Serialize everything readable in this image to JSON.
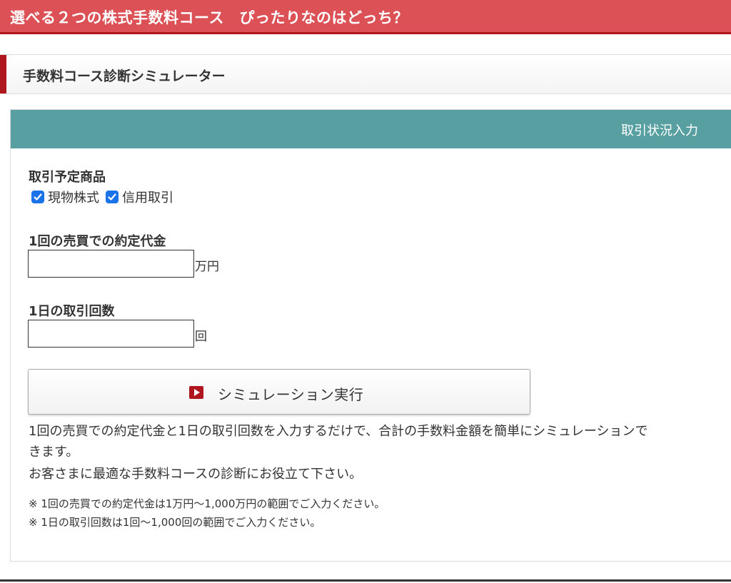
{
  "banner": {
    "title": "選べる２つの株式手数料コース　ぴったりなのはどっち？",
    "color": "#dc5156"
  },
  "section": {
    "title": "手数料コース診断シミュレーター"
  },
  "panel": {
    "header": "取引状況入力",
    "header_color": "#589fa1",
    "products": {
      "title": "取引予定商品",
      "options": [
        {
          "label": "現物株式",
          "checked": true
        },
        {
          "label": "信用取引",
          "checked": true
        }
      ]
    },
    "amount": {
      "title": "1回の売買での約定代金",
      "value": "",
      "unit": "万円"
    },
    "count": {
      "title": "1日の取引回数",
      "value": "",
      "unit": "回"
    },
    "button": {
      "icon": "play-icon",
      "label": "シミュレーション実行"
    },
    "description": [
      "1回の売買での約定代金と1日の取引回数を入力するだけで、合計の手数料金額を簡単にシミュレーションで",
      "きます。",
      "お客さまに最適な手数料コースの診断にお役立て下さい。"
    ],
    "notes": [
      "※  1回の売買での約定代金は1万円～1,000万円の範囲でご入力ください。",
      "※  1日の取引回数は1回～1,000回の範囲でご入力ください。"
    ]
  }
}
